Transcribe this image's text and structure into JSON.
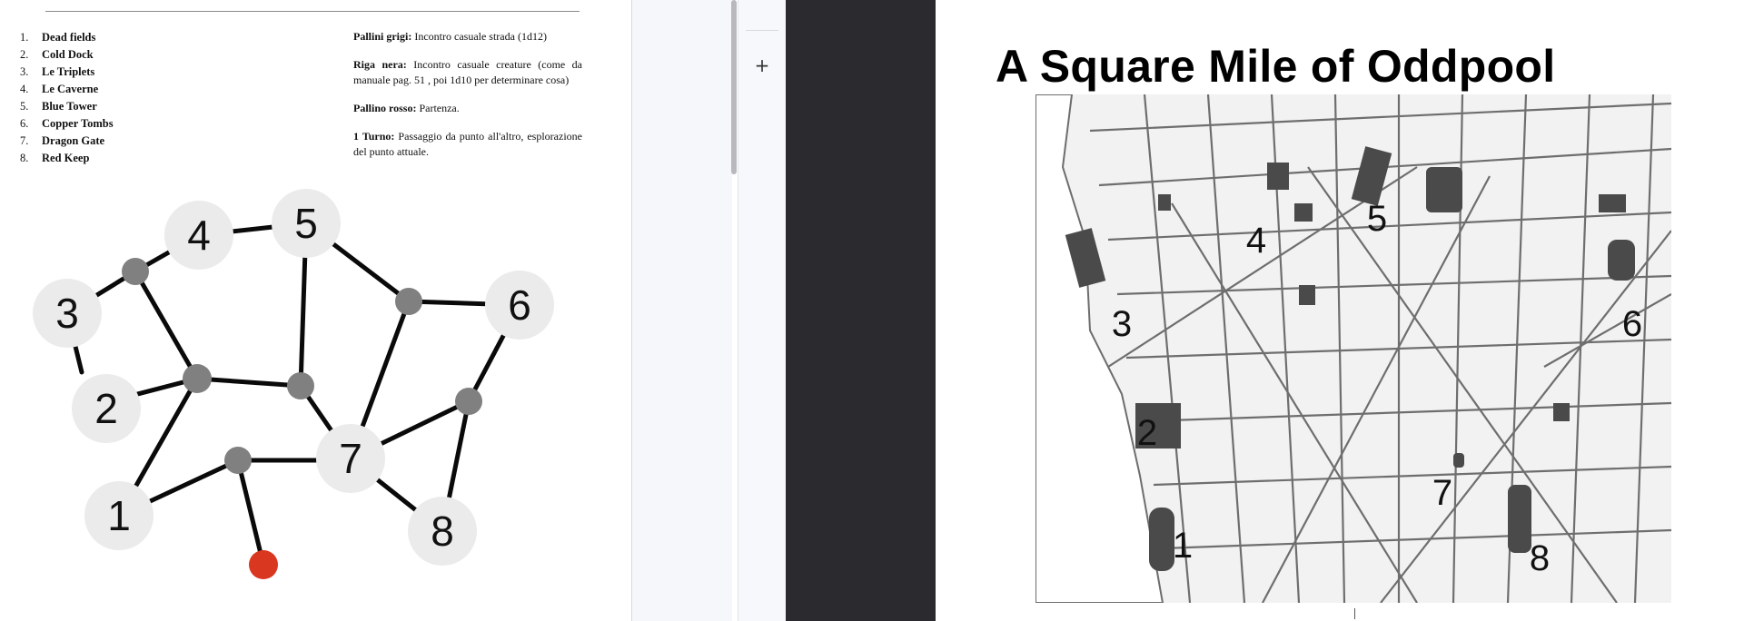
{
  "document": {
    "locations": [
      {
        "num": "1.",
        "name": "Dead fields"
      },
      {
        "num": "2.",
        "name": "Cold Dock"
      },
      {
        "num": "3.",
        "name": "Le Triplets"
      },
      {
        "num": "4.",
        "name": "Le Caverne"
      },
      {
        "num": "5.",
        "name": "Blue Tower"
      },
      {
        "num": "6.",
        "name": "Copper Tombs"
      },
      {
        "num": "7.",
        "name": "Dragon Gate"
      },
      {
        "num": "8.",
        "name": "Red Keep"
      }
    ],
    "notes": [
      {
        "label": "Pallini grigi:",
        "text": "Incontro casuale strada (1d12)"
      },
      {
        "label": "Riga nera:",
        "text": "Incontro casuale creature (come da manuale pag. 51 , poi 1d10 per determinare cosa)"
      },
      {
        "label": "Pallino rosso:",
        "text": "Partenza."
      },
      {
        "label": "1 Turno:",
        "text": "Passaggio da punto all'altro, esplorazione del punto attuale."
      }
    ],
    "graph_nodes": [
      "1",
      "2",
      "3",
      "4",
      "5",
      "6",
      "7",
      "8"
    ],
    "colors": {
      "node_fill": "#ebebeb",
      "junction": "#808080",
      "start": "#d9371f",
      "edge": "#0a0a0a"
    }
  },
  "toolbar": {
    "add_icon": "+",
    "add_icon_name": "plus-icon"
  },
  "map_panel": {
    "title": "A Square Mile of Oddpool",
    "map_labels": [
      "1",
      "2",
      "3",
      "4",
      "5",
      "6",
      "7",
      "8"
    ]
  }
}
